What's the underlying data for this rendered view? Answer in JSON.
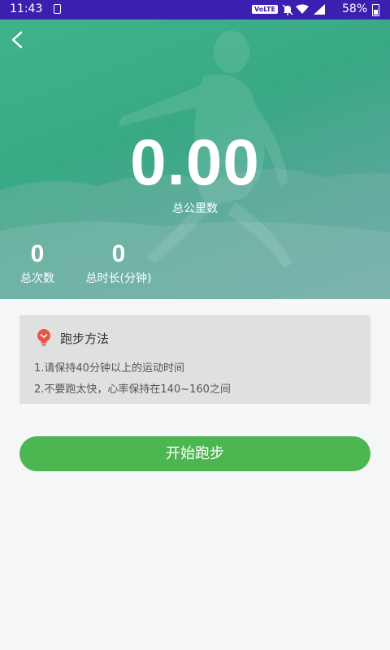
{
  "status_bar": {
    "time": "11:43",
    "network_badge": "VoLTE",
    "battery_percent": "58%",
    "icons": [
      "sim-icon",
      "mute-icon",
      "wifi-icon",
      "signal-icon",
      "battery-icon"
    ]
  },
  "header": {
    "back_icon": "chevron-left-icon"
  },
  "summary": {
    "total_distance_value": "0.00",
    "total_distance_label": "总公里数",
    "total_count_value": "0",
    "total_count_label": "总次数",
    "total_duration_value": "0",
    "total_duration_label": "总时长(分钟)"
  },
  "tips": {
    "icon": "lightbulb-icon",
    "title": "跑步方法",
    "items": [
      "1.请保持40分钟以上的运动时间",
      "2.不要跑太快，心率保持在140~160之间"
    ]
  },
  "actions": {
    "start_label": "开始跑步"
  },
  "colors": {
    "status_bar": "#3b1fb0",
    "hero_green": "#3fb38a",
    "button_green": "#4cb651",
    "tips_icon_red": "#e8544a"
  }
}
